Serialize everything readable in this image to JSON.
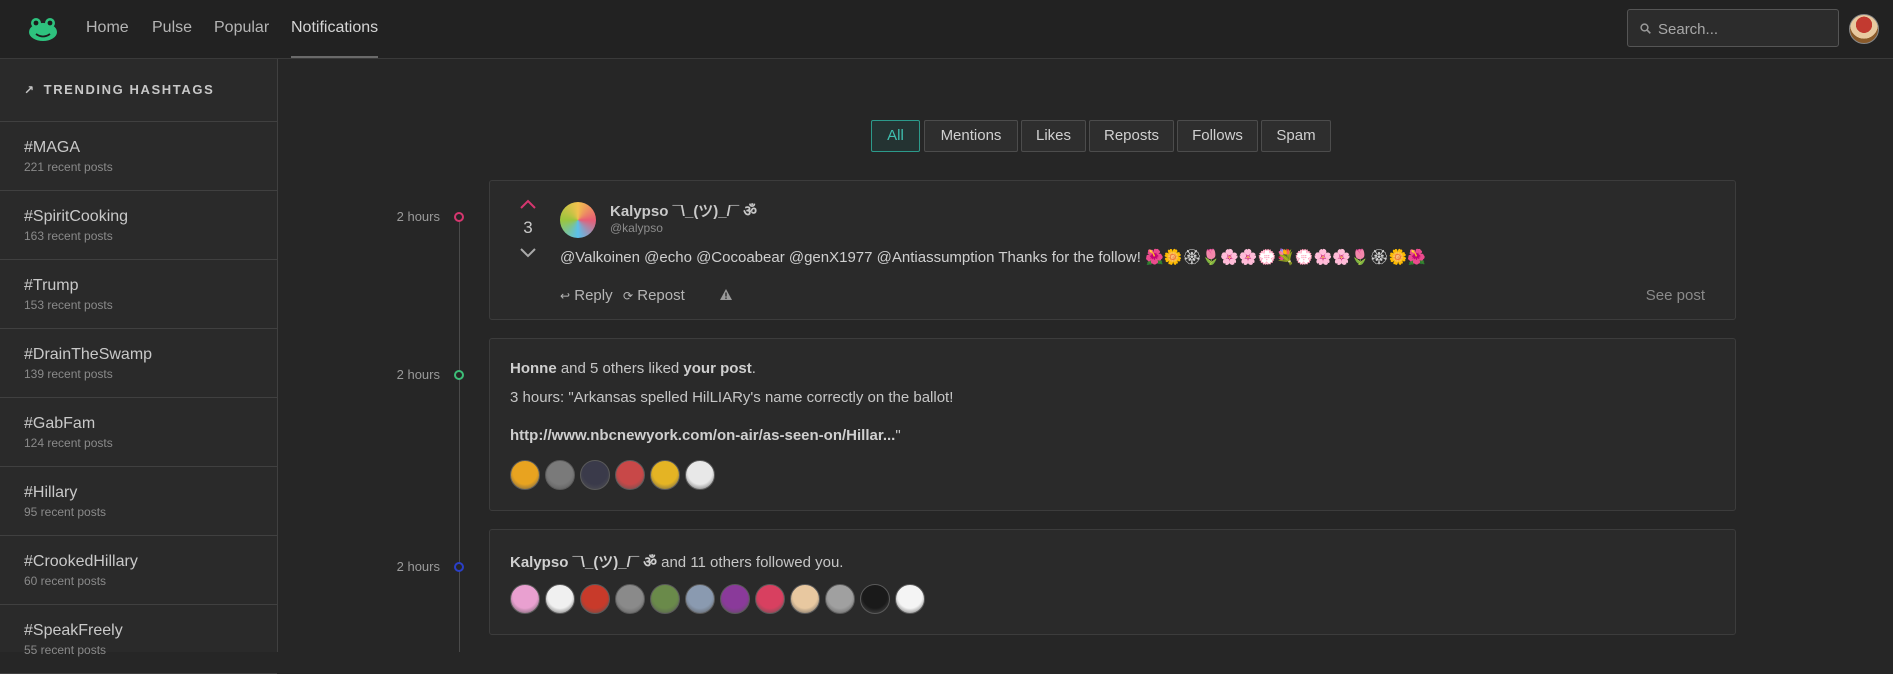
{
  "nav": {
    "links": [
      {
        "label": "Home",
        "active": false
      },
      {
        "label": "Pulse",
        "active": false
      },
      {
        "label": "Popular",
        "active": false
      },
      {
        "label": "Notifications",
        "active": true
      }
    ],
    "search_placeholder": "Search..."
  },
  "sidebar": {
    "title": "TRENDING HASHTAGS",
    "tags": [
      {
        "name": "#MAGA",
        "count": "221 recent posts"
      },
      {
        "name": "#SpiritCooking",
        "count": "163 recent posts"
      },
      {
        "name": "#Trump",
        "count": "153 recent posts"
      },
      {
        "name": "#DrainTheSwamp",
        "count": "139 recent posts"
      },
      {
        "name": "#GabFam",
        "count": "124 recent posts"
      },
      {
        "name": "#Hillary",
        "count": "95 recent posts"
      },
      {
        "name": "#CrookedHillary",
        "count": "60 recent posts"
      },
      {
        "name": "#SpeakFreely",
        "count": "55 recent posts"
      }
    ]
  },
  "filters": [
    "All",
    "Mentions",
    "Likes",
    "Reposts",
    "Follows",
    "Spam"
  ],
  "timeline": [
    {
      "time": "2 hours",
      "dot_color": "#d6366f"
    },
    {
      "time": "2 hours",
      "dot_color": "#3dbf78"
    },
    {
      "time": "2 hours",
      "dot_color": "#2a3fc8"
    }
  ],
  "mention_card": {
    "score": "3",
    "author": "Kalypso ¯\\_(ツ)_/¯ ॐ",
    "handle": "@kalypso",
    "body": "@Valkoinen @echo @Cocoabear @genX1977 @Antiassumption Thanks for the follow! 🌺🌼🏵🌷🌸🌸💮💐💮🌸🌸🌷🏵🌼🌺",
    "reply_label": "Reply",
    "repost_label": "Repost",
    "see_post_label": "See post"
  },
  "like_card": {
    "actor": "Honne",
    "middle": " and 5 others liked ",
    "target": "your post",
    "end": ".",
    "excerpt": "3 hours: \"Arkansas spelled HilLIARy's name correctly on the ballot!",
    "link": "http://www.nbcnewyork.com/on-air/as-seen-on/Hillar...",
    "link_suffix": "\"",
    "avatar_colors": [
      "#e8a320",
      "#7a7a7a",
      "#3a3a4a",
      "#c84848",
      "#e4b424",
      "#e8e8e8"
    ]
  },
  "follow_card": {
    "actor": "Kalypso ¯\\_(ツ)_/¯ ॐ",
    "rest": " and 11 others followed you.",
    "avatar_colors": [
      "#e9a0d0",
      "#f0f0f0",
      "#c83a2a",
      "#8a8a8a",
      "#6a8a4a",
      "#8a9ab0",
      "#8a3a9a",
      "#d84060",
      "#e8c8a0",
      "#a0a0a0",
      "#1a1a1a",
      "#f4f4f4"
    ]
  }
}
